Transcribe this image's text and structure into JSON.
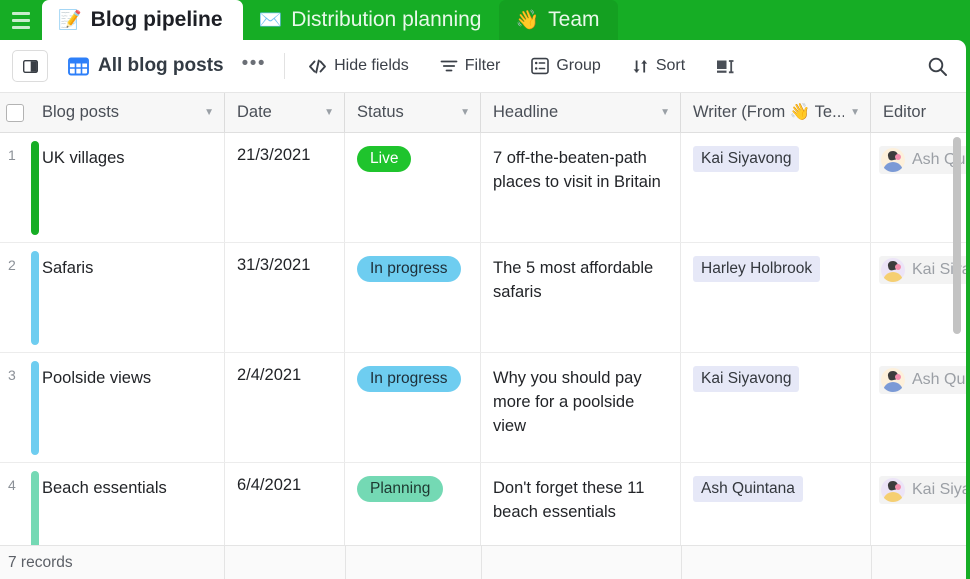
{
  "theme": {
    "brand_green": "#16ad25",
    "tab_hover_green": "#14a021",
    "grid_icon_blue": "#2d7ff9",
    "chip_lavender": "#e6e8f7"
  },
  "tabs": [
    {
      "emoji": "📝",
      "label": "Blog pipeline",
      "state": "active"
    },
    {
      "emoji": "✉️",
      "label": "Distribution planning",
      "state": "normal"
    },
    {
      "emoji": "👋",
      "label": "Team",
      "state": "hovered"
    }
  ],
  "toolbar": {
    "sidebar_toggle_icon": "sidebar-toggle-icon",
    "view_icon": "grid-view-icon",
    "view_name": "All blog posts",
    "more_label": "•••",
    "items": [
      {
        "icon": "hide-fields-icon",
        "label": "Hide fields"
      },
      {
        "icon": "filter-icon",
        "label": "Filter"
      },
      {
        "icon": "group-icon",
        "label": "Group"
      },
      {
        "icon": "sort-icon",
        "label": "Sort"
      },
      {
        "icon": "row-height-icon",
        "label": ""
      }
    ],
    "search_icon": "search-icon"
  },
  "grid": {
    "columns": [
      {
        "key": "name",
        "label": "Blog posts",
        "has_caret": true
      },
      {
        "key": "date",
        "label": "Date",
        "has_caret": true
      },
      {
        "key": "status",
        "label": "Status",
        "has_caret": true
      },
      {
        "key": "headline",
        "label": "Headline",
        "has_caret": true
      },
      {
        "key": "writer",
        "label": "Writer (From 👋 Te...",
        "has_caret": true
      },
      {
        "key": "editor",
        "label": "Editor",
        "has_caret": false
      }
    ],
    "rows": [
      {
        "num": "1",
        "color": "#16ad25",
        "name": "UK villages",
        "date": "21/3/2021",
        "status": "Live",
        "status_bg": "#1fc42d",
        "status_fg": "#ffffff",
        "headline": "7 off-the-beaten-path places to visit in Britain",
        "writer": "Kai Siyavong",
        "editor": "Ash Quintana",
        "editor_avatar": "ash"
      },
      {
        "num": "2",
        "color": "#6ecdf0",
        "name": "Safaris",
        "date": "31/3/2021",
        "status": "In progress",
        "status_bg": "#6ecdf0",
        "status_fg": "#1d2e38",
        "headline": "The 5 most affordable safaris",
        "writer": "Harley Holbrook",
        "editor": "Kai Siyavong",
        "editor_avatar": "kai"
      },
      {
        "num": "3",
        "color": "#6ecdf0",
        "name": "Poolside views",
        "date": "2/4/2021",
        "status": "In progress",
        "status_bg": "#6ecdf0",
        "status_fg": "#1d2e38",
        "headline": "Why you should pay more for a poolside view",
        "writer": "Kai Siyavong",
        "editor": "Ash Quintana",
        "editor_avatar": "ash"
      },
      {
        "num": "4",
        "color": "#74d9b4",
        "name": "Beach essentials",
        "date": "6/4/2021",
        "status": "Planning",
        "status_bg": "#74d9b4",
        "status_fg": "#1d3830",
        "headline": "Don't forget these 11 beach essentials",
        "writer": "Ash Quintana",
        "editor": "Kai Siyavong",
        "editor_avatar": "kai"
      }
    ]
  },
  "footer": {
    "records": "7 records"
  }
}
